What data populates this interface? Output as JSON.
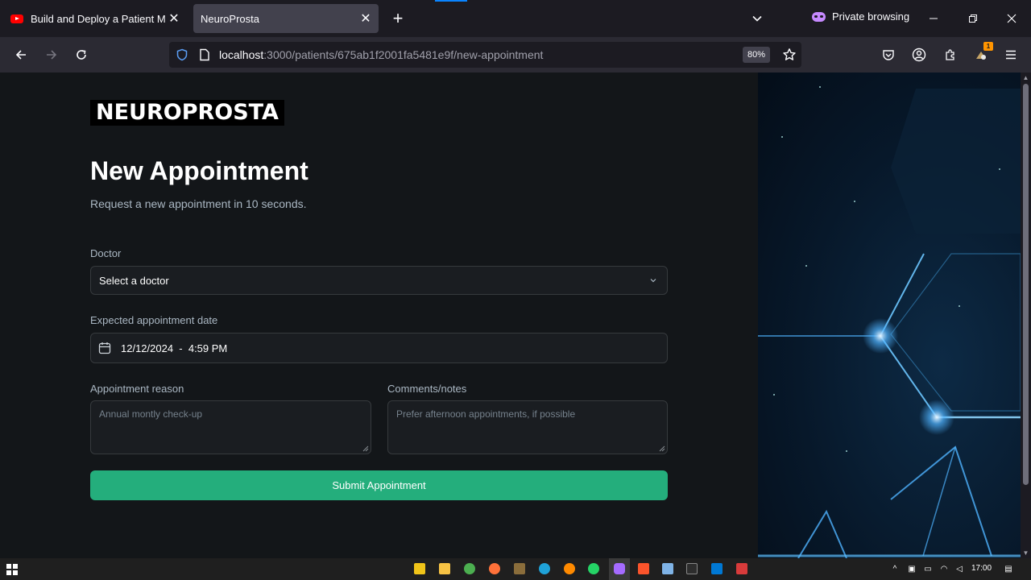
{
  "browser": {
    "tabs": [
      {
        "title": "Build and Deploy a Patient Mana",
        "favicon": "youtube-icon",
        "active": false
      },
      {
        "title": "NeuroProsta",
        "favicon": "",
        "active": true
      }
    ],
    "private_label": "Private browsing",
    "url_host": "localhost",
    "url_path": ":3000/patients/675ab1f2001fa5481e9f/new-appointment",
    "zoom": "80%",
    "extension_badge": "1"
  },
  "page": {
    "logo": "NEUROPROSTA",
    "title": "New Appointment",
    "subtitle": "Request a new appointment in 10 seconds.",
    "doctor": {
      "label": "Doctor",
      "value": "Select a doctor"
    },
    "date": {
      "label": "Expected appointment date",
      "value": "12/12/2024  -  4:59 PM"
    },
    "reason": {
      "label": "Appointment reason",
      "placeholder": "Annual montly check-up"
    },
    "notes": {
      "label": "Comments/notes",
      "placeholder": "Prefer afternoon appointments, if possible"
    },
    "submit_label": "Submit Appointment"
  },
  "taskbar": {
    "time": "17:00"
  },
  "colors": {
    "accent": "#24ae7c",
    "page_bg": "#131619",
    "input_bg": "#1a1d21",
    "input_border": "#363a3d",
    "muted_text": "#abb8c4"
  }
}
